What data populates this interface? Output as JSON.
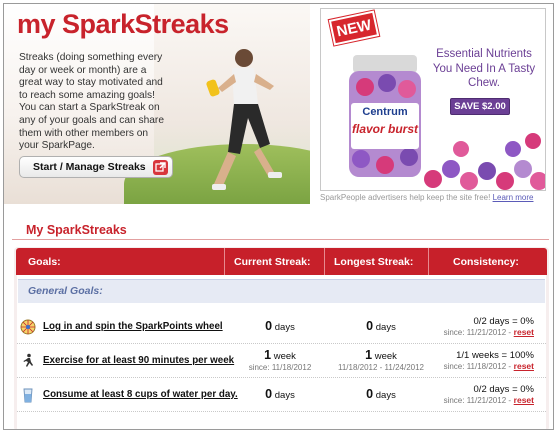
{
  "hero": {
    "title_prefix": "my",
    "title_main": "SparkStreaks",
    "description": "Streaks (doing something every day or week or month) are a great way to stay motivated and to reach some amazing goals! You can start a SparkStreak on any of your goals and can share them with other members on your SparkPage.",
    "button_label": "Start / Manage Streaks"
  },
  "ad": {
    "badge": "NEW",
    "headline": "Essential Nutrients You Need In A Tasty Chew.",
    "save_label": "SAVE $2.00",
    "brand": "Centrum",
    "product": "flavor burst",
    "caption_prefix": "SparkPeople advertisers help keep the site free!",
    "caption_link": "Learn more"
  },
  "section": {
    "title": "My SparkStreaks"
  },
  "table": {
    "headers": [
      "Goals:",
      "Current Streak:",
      "Longest Streak:",
      "Consistency:"
    ],
    "group_label": "General Goals:",
    "rows": [
      {
        "icon": "spark-points-wheel-icon",
        "goal": "Log in and spin the SparkPoints wheel",
        "current_value": "0",
        "current_unit": "days",
        "current_since": "",
        "longest_value": "0",
        "longest_unit": "days",
        "longest_range": "",
        "consistency": "0/2 days = 0%",
        "since": "since: 11/21/2012 -",
        "reset": "reset"
      },
      {
        "icon": "exercise-runner-icon",
        "goal": "Exercise for at least 90 minutes per week",
        "current_value": "1",
        "current_unit": "week",
        "current_since": "since: 11/18/2012",
        "longest_value": "1",
        "longest_unit": "week",
        "longest_range": "11/18/2012 - 11/24/2012",
        "consistency": "1/1 weeks = 100%",
        "since": "since: 11/18/2012 -",
        "reset": "reset"
      },
      {
        "icon": "water-glass-icon",
        "goal": "Consume at least 8 cups of water per day.",
        "current_value": "0",
        "current_unit": "days",
        "current_since": "",
        "longest_value": "0",
        "longest_unit": "days",
        "longest_range": "",
        "consistency": "0/2 days = 0%",
        "since": "since: 11/21/2012 -",
        "reset": "reset"
      }
    ]
  },
  "colors": {
    "brand_red": "#c8232c",
    "ad_purple": "#6b3f95",
    "group_blue": "#5b6fa3"
  }
}
